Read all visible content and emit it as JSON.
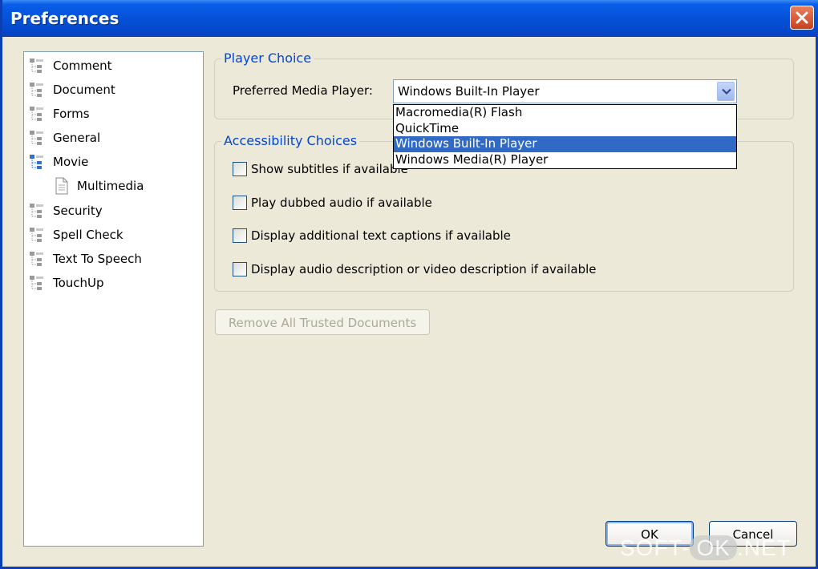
{
  "window": {
    "title": "Preferences"
  },
  "tree": {
    "items": [
      {
        "label": "Comment",
        "child": false,
        "selected": false
      },
      {
        "label": "Document",
        "child": false,
        "selected": false
      },
      {
        "label": "Forms",
        "child": false,
        "selected": false
      },
      {
        "label": "General",
        "child": false,
        "selected": false
      },
      {
        "label": "Movie",
        "child": false,
        "selected": true
      },
      {
        "label": "Multimedia",
        "child": true,
        "selected": false
      },
      {
        "label": "Security",
        "child": false,
        "selected": false
      },
      {
        "label": "Spell Check",
        "child": false,
        "selected": false
      },
      {
        "label": "Text To Speech",
        "child": false,
        "selected": false
      },
      {
        "label": "TouchUp",
        "child": false,
        "selected": false
      }
    ]
  },
  "player_choice": {
    "legend": "Player Choice",
    "label": "Preferred Media Player:",
    "selected": "Windows Built-In Player",
    "options": [
      "Macromedia(R) Flash",
      "QuickTime",
      "Windows Built-In Player",
      "Windows Media(R) Player"
    ],
    "highlighted_index": 2
  },
  "accessibility": {
    "legend": "Accessibility Choices",
    "options": [
      {
        "label": "Show subtitles if available",
        "checked": false
      },
      {
        "label": "Play dubbed audio if available",
        "checked": false
      },
      {
        "label": "Display additional text captions if available",
        "checked": false
      },
      {
        "label": "Display audio description or video description if available",
        "checked": false
      }
    ]
  },
  "buttons": {
    "remove_trusted": "Remove All Trusted Documents",
    "ok": "OK",
    "cancel": "Cancel"
  },
  "watermark": {
    "prefix": "SOFT-",
    "mid": "OK",
    "suffix": ".NET"
  },
  "colors": {
    "title_bar": "#0452d8",
    "legend": "#0046d5",
    "highlight": "#316ac5",
    "close": "#c9411e"
  }
}
